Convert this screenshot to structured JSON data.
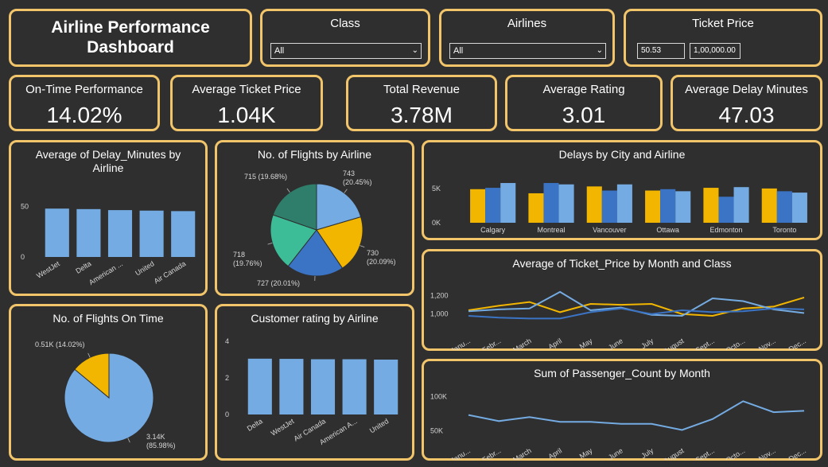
{
  "title": "Airline Performance Dashboard",
  "filters": {
    "class": {
      "label": "Class",
      "value": "All"
    },
    "airlines": {
      "label": "Airlines",
      "value": "All"
    },
    "ticket_price": {
      "label": "Ticket Price",
      "min": "50.53",
      "max": "1,00,000.00"
    }
  },
  "kpis": [
    {
      "label": "On-Time Performance",
      "value": "14.02%"
    },
    {
      "label": "Average Ticket Price",
      "value": "1.04K"
    },
    {
      "label": "Total Revenue",
      "value": "3.78M"
    },
    {
      "label": "Average Rating",
      "value": "3.01"
    },
    {
      "label": "Average Delay Minutes",
      "value": "47.03"
    }
  ],
  "colors": {
    "border": "#f2c56b",
    "bg": "#2f2f2f",
    "light_blue": "#74abe2",
    "blue": "#3b74c4",
    "yellow": "#f2b600",
    "teal": "#3cbc97",
    "dark_teal": "#2e7e6b"
  },
  "chart_data": [
    {
      "id": "delay_by_airline",
      "type": "bar",
      "title": "Average of Delay_Minutes by Airline",
      "categories": [
        "WestJet",
        "Delta",
        "American ...",
        "United",
        "Air Canada"
      ],
      "values": [
        48,
        47.5,
        46.5,
        46,
        45.5
      ],
      "yticks": [
        "50",
        "0"
      ],
      "ylim": [
        0,
        60
      ]
    },
    {
      "id": "flights_by_airline",
      "type": "pie",
      "title": "No. of Flights by Airline",
      "values": [
        743,
        730,
        727,
        718,
        715
      ],
      "labels": [
        "743\n(20.45%)",
        "730\n(20.09%)",
        "727 (20.01%)",
        "718\n(19.76%)",
        "715 (19.68%)"
      ]
    },
    {
      "id": "delays_city_airline",
      "type": "bar",
      "title": "Delays by City and Airline",
      "categories": [
        "Calgary",
        "Montreal",
        "Vancouver",
        "Ottawa",
        "Edmonton",
        "Toronto"
      ],
      "series": [
        {
          "values": [
            4900,
            4300,
            5300,
            4700,
            5100,
            5000
          ]
        },
        {
          "values": [
            5100,
            5800,
            4700,
            4900,
            3800,
            4600
          ]
        },
        {
          "values": [
            5800,
            5600,
            5600,
            4600,
            5200,
            4400
          ]
        }
      ],
      "yticks": [
        "5K",
        "0K"
      ],
      "ylim": [
        0,
        6500
      ]
    },
    {
      "id": "ticket_price_month_class",
      "type": "line",
      "title": "Average of Ticket_Price by Month and Class",
      "categories": [
        "Janu...",
        "Febr...",
        "March",
        "April",
        "May",
        "June",
        "July",
        "August",
        "Sept...",
        "Octo...",
        "Nov...",
        "Dec..."
      ],
      "series": [
        {
          "values": [
            1040,
            1090,
            1130,
            1020,
            1110,
            1100,
            1110,
            1000,
            980,
            1060,
            1080,
            1180
          ]
        },
        {
          "values": [
            1030,
            1050,
            1060,
            1240,
            1040,
            1070,
            990,
            980,
            1170,
            1140,
            1050,
            1010
          ]
        },
        {
          "values": [
            980,
            960,
            950,
            950,
            1020,
            1060,
            1000,
            1040,
            1020,
            1030,
            1060,
            1050
          ]
        }
      ],
      "yticks": [
        "1,200",
        "1,000"
      ],
      "ylim": [
        850,
        1300
      ]
    },
    {
      "id": "flights_on_time",
      "type": "pie",
      "title": "No. of Flights On Time",
      "values": [
        3.14,
        0.51
      ],
      "labels": [
        "3.14K\n(85.98%)",
        "0.51K (14.02%)"
      ]
    },
    {
      "id": "rating_by_airline",
      "type": "bar",
      "title": "Customer rating by Airline",
      "categories": [
        "Delta",
        "WestJet",
        "Air Canada",
        "American A...",
        "United"
      ],
      "values": [
        3.05,
        3.04,
        3.02,
        3.02,
        3.0
      ],
      "yticks": [
        "4",
        "2",
        "0"
      ],
      "ylim": [
        0,
        4
      ]
    },
    {
      "id": "passenger_by_month",
      "type": "line",
      "title": "Sum of Passenger_Count by Month",
      "categories": [
        "Janu...",
        "Febr...",
        "March",
        "April",
        "May",
        "June",
        "July",
        "August",
        "Sept...",
        "Octo...",
        "Nov...",
        "Dec..."
      ],
      "values": [
        73000,
        64000,
        70000,
        63000,
        63000,
        60000,
        60000,
        51000,
        67000,
        93000,
        77000,
        79000
      ],
      "yticks": [
        "100K",
        "50K"
      ],
      "ylim": [
        40000,
        105000
      ]
    }
  ]
}
